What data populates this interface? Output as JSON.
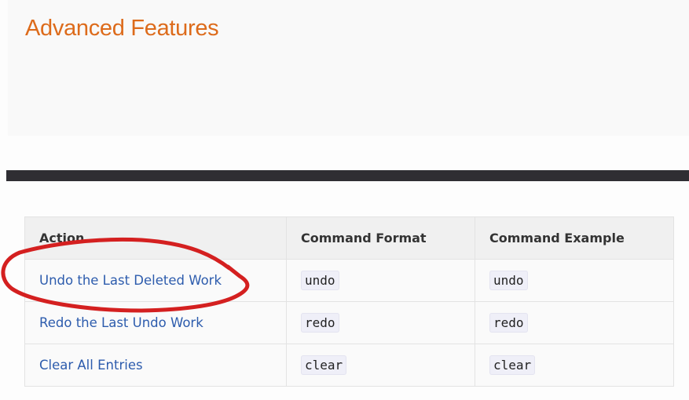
{
  "section": {
    "title": "Advanced Features"
  },
  "table": {
    "headers": [
      "Action",
      "Command Format",
      "Command Example"
    ],
    "rows": [
      {
        "action": "Undo the Last Deleted Work",
        "format": "undo",
        "example": "undo"
      },
      {
        "action": "Redo the Last Undo Work",
        "format": "redo",
        "example": "redo"
      },
      {
        "action": "Clear All Entries",
        "format": "clear",
        "example": "clear"
      }
    ]
  },
  "annotation": {
    "color": "#d42020"
  }
}
